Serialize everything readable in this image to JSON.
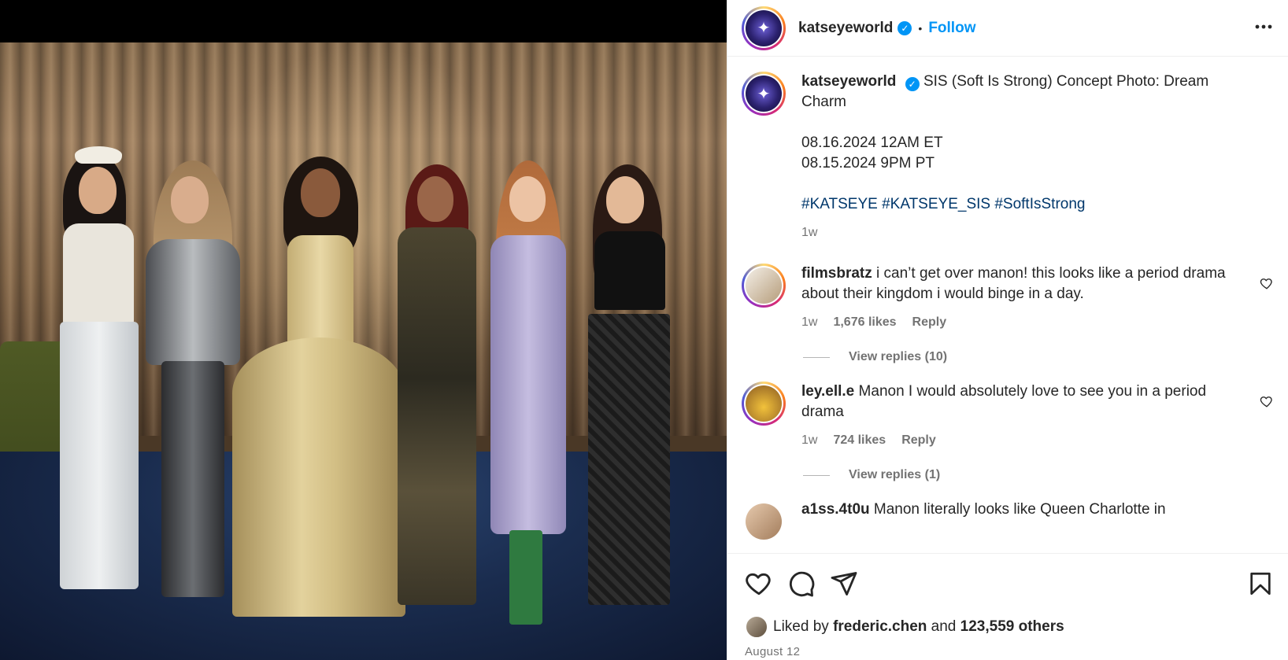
{
  "post": {
    "username": "katseyeworld",
    "verified_mark": "✓",
    "dot": "•",
    "follow_label": "Follow",
    "more_label": "•••"
  },
  "caption": {
    "username": "katseyeworld",
    "title": "SIS (Soft Is Strong) Concept Photo: Dream Charm",
    "line1": "08.16.2024 12AM ET",
    "line2": "08.15.2024 9PM PT",
    "hashtags": "#KATSEYE #KATSEYE_SIS #SoftIsStrong",
    "time": "1w"
  },
  "comments": [
    {
      "username": "filmsbratz",
      "text": "i can’t get over manon! this looks like a period drama about their kingdom i would binge in a day.",
      "time": "1w",
      "likes": "1,676 likes",
      "reply": "Reply",
      "view_replies": "View replies (10)"
    },
    {
      "username": "ley.ell.e",
      "text": "Manon I would absolutely love to see you in a period drama",
      "time": "1w",
      "likes": "724 likes",
      "reply": "Reply",
      "view_replies": "View replies (1)"
    },
    {
      "username": "a1ss.4t0u",
      "text": "Manon literally looks like Queen Charlotte in"
    }
  ],
  "footer": {
    "liked_prefix": "Liked by",
    "liked_user": "frederic.chen",
    "liked_and": "and",
    "liked_others": "123,559 others",
    "date": "August 12"
  },
  "icons": {
    "like": "heart-icon",
    "comment": "comment-icon",
    "share": "share-icon",
    "save": "bookmark-icon"
  },
  "colors": {
    "accent": "#0095f6",
    "hashtag": "#00376b",
    "muted": "#737373"
  }
}
